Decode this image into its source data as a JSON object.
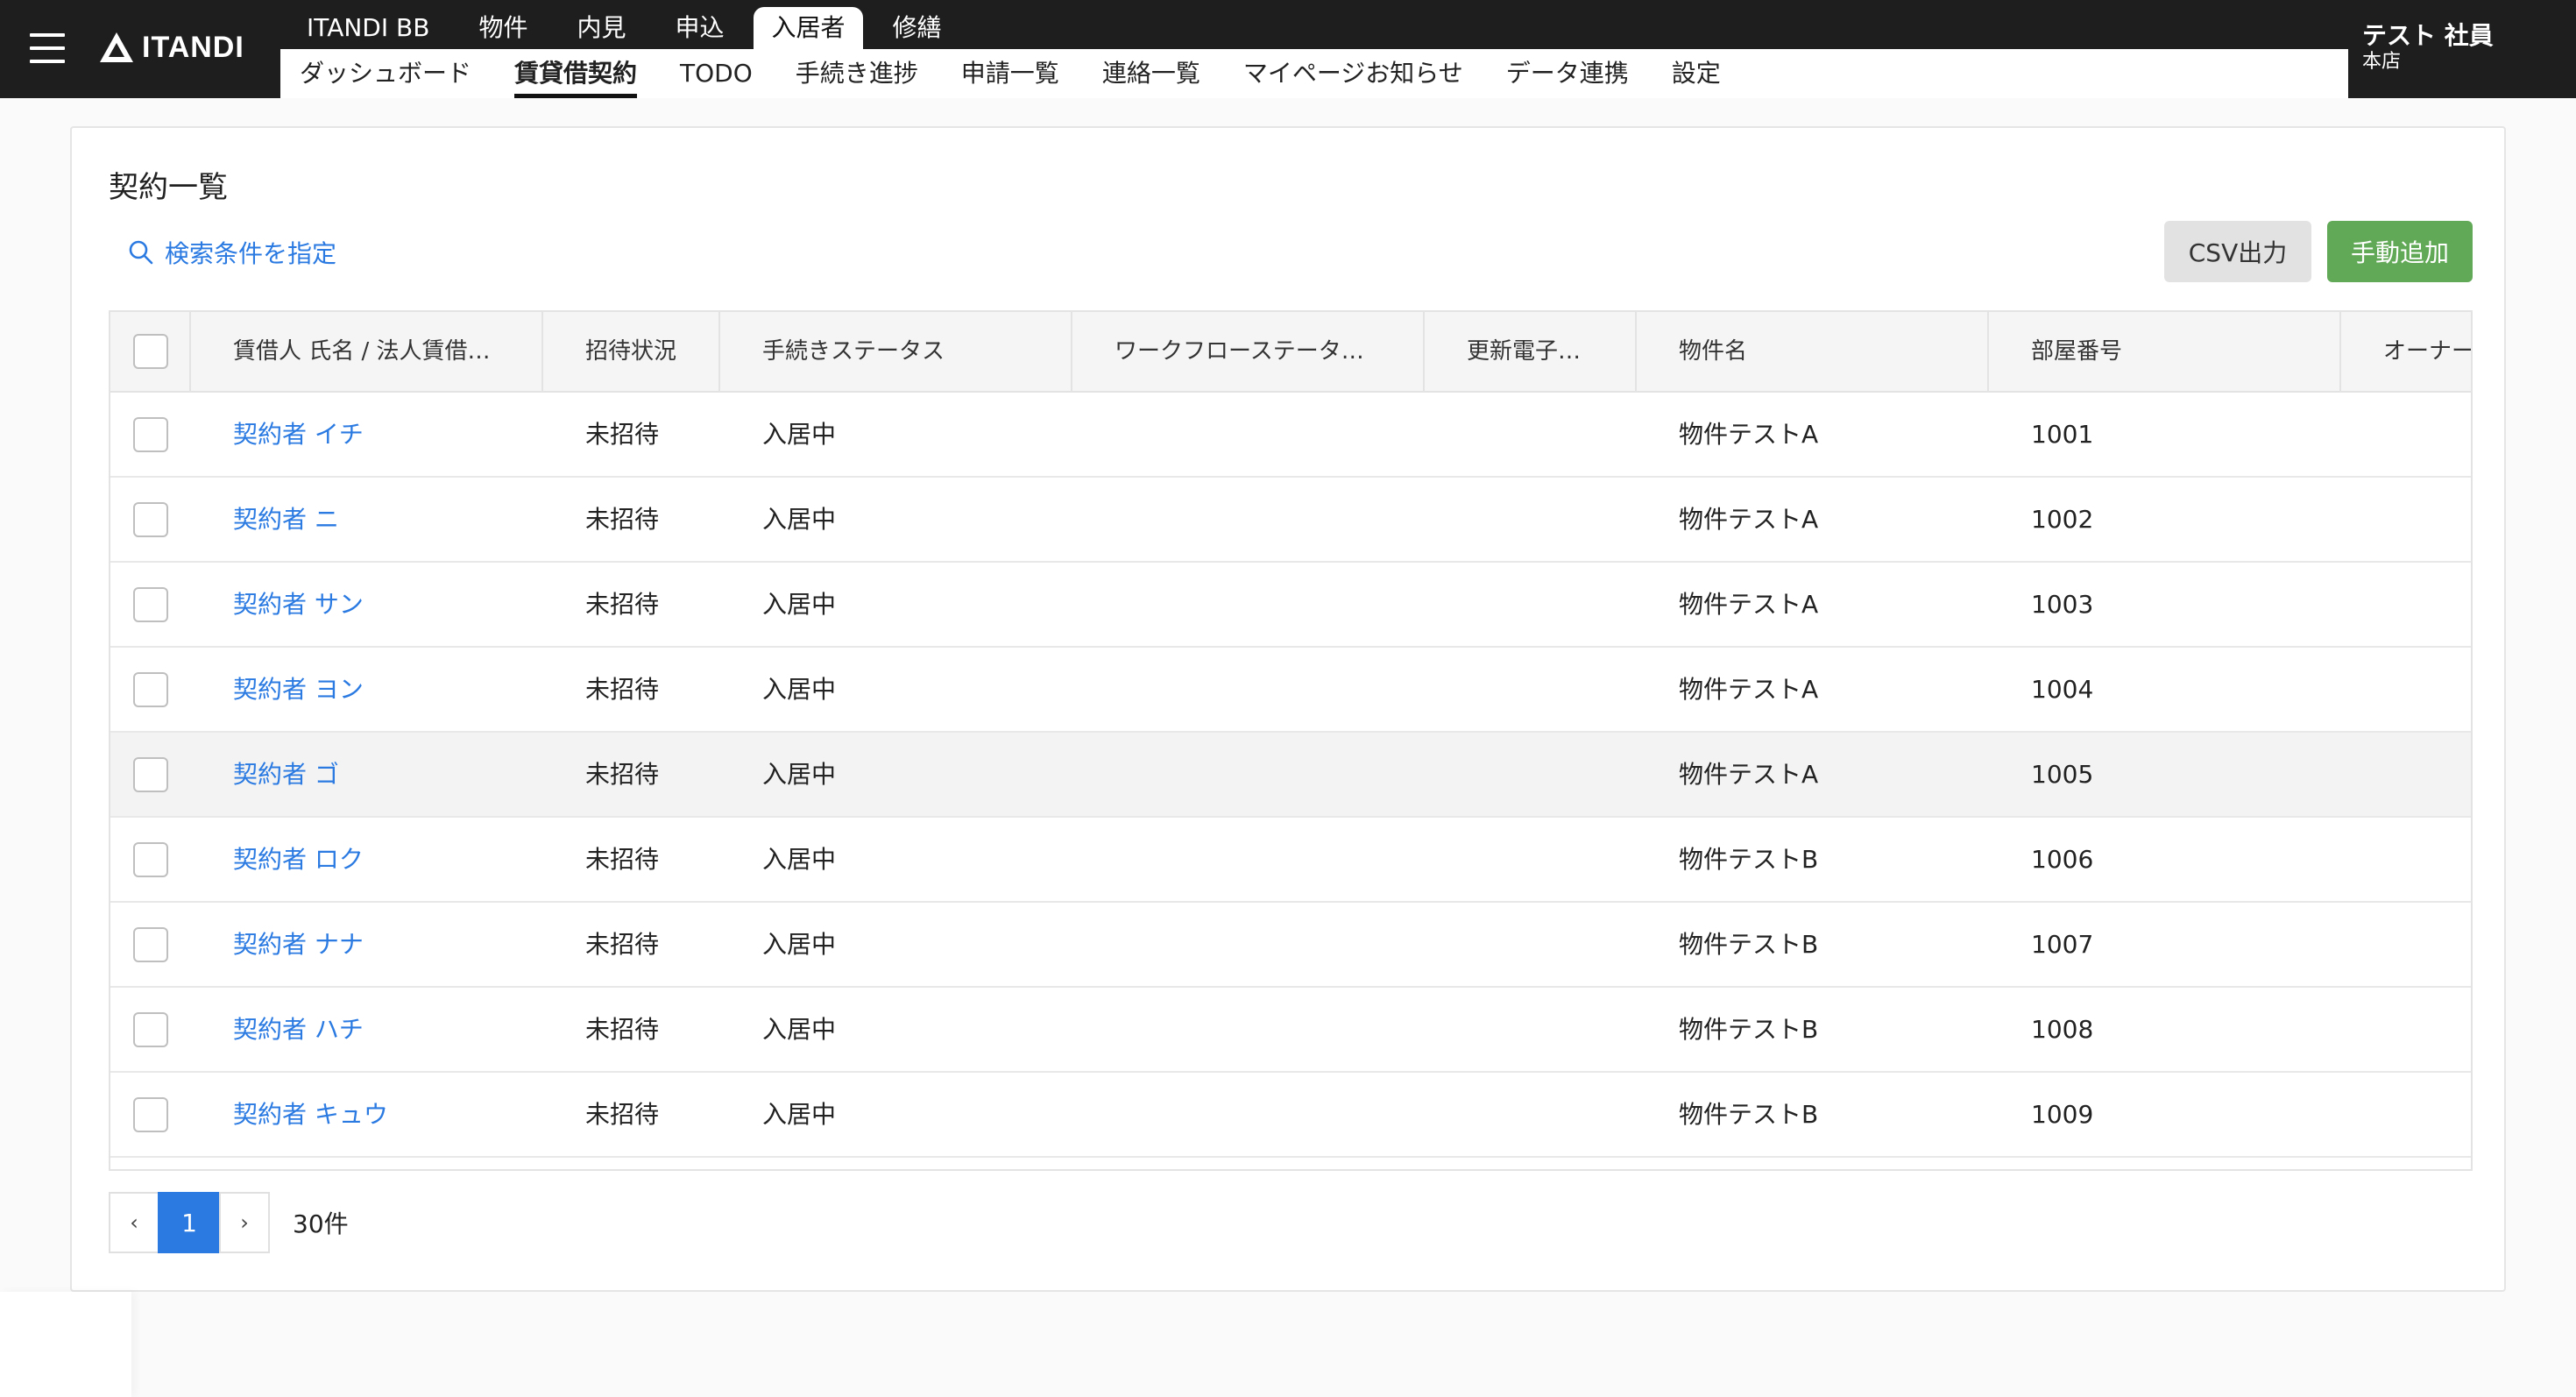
{
  "header": {
    "logo_text": "ITANDI",
    "primary_nav": [
      {
        "label": "ITANDI BB",
        "active": false
      },
      {
        "label": "物件",
        "active": false
      },
      {
        "label": "内見",
        "active": false
      },
      {
        "label": "申込",
        "active": false
      },
      {
        "label": "入居者",
        "active": true
      },
      {
        "label": "修繕",
        "active": false
      }
    ],
    "secondary_nav": [
      {
        "label": "ダッシュボード",
        "active": false
      },
      {
        "label": "賃貸借契約",
        "active": true
      },
      {
        "label": "TODO",
        "active": false
      },
      {
        "label": "手続き進捗",
        "active": false
      },
      {
        "label": "申請一覧",
        "active": false
      },
      {
        "label": "連絡一覧",
        "active": false
      },
      {
        "label": "マイページお知らせ",
        "active": false
      },
      {
        "label": "データ連携",
        "active": false
      },
      {
        "label": "設定",
        "active": false
      }
    ],
    "user": {
      "name": "テスト 社員",
      "branch": "本店"
    }
  },
  "main": {
    "title": "契約一覧",
    "search_link": "検索条件を指定",
    "csv_button": "CSV出力",
    "add_button": "手動追加"
  },
  "table": {
    "columns": [
      "賃借人 氏名 / 法人賃借…",
      "招待状況",
      "手続きステータス",
      "ワークフローステータ…",
      "更新電子…",
      "物件名",
      "部屋番号",
      "オーナー"
    ],
    "rows": [
      {
        "name": "契約者 イチ",
        "invite": "未招待",
        "status": "入居中",
        "workflow": "",
        "renewal": "",
        "property": "物件テストA",
        "room": "1001",
        "owner": ""
      },
      {
        "name": "契約者 ニ",
        "invite": "未招待",
        "status": "入居中",
        "workflow": "",
        "renewal": "",
        "property": "物件テストA",
        "room": "1002",
        "owner": ""
      },
      {
        "name": "契約者 サン",
        "invite": "未招待",
        "status": "入居中",
        "workflow": "",
        "renewal": "",
        "property": "物件テストA",
        "room": "1003",
        "owner": ""
      },
      {
        "name": "契約者 ヨン",
        "invite": "未招待",
        "status": "入居中",
        "workflow": "",
        "renewal": "",
        "property": "物件テストA",
        "room": "1004",
        "owner": ""
      },
      {
        "name": "契約者 ゴ",
        "invite": "未招待",
        "status": "入居中",
        "workflow": "",
        "renewal": "",
        "property": "物件テストA",
        "room": "1005",
        "owner": ""
      },
      {
        "name": "契約者 ロク",
        "invite": "未招待",
        "status": "入居中",
        "workflow": "",
        "renewal": "",
        "property": "物件テストB",
        "room": "1006",
        "owner": ""
      },
      {
        "name": "契約者 ナナ",
        "invite": "未招待",
        "status": "入居中",
        "workflow": "",
        "renewal": "",
        "property": "物件テストB",
        "room": "1007",
        "owner": ""
      },
      {
        "name": "契約者 ハチ",
        "invite": "未招待",
        "status": "入居中",
        "workflow": "",
        "renewal": "",
        "property": "物件テストB",
        "room": "1008",
        "owner": ""
      },
      {
        "name": "契約者 キュウ",
        "invite": "未招待",
        "status": "入居中",
        "workflow": "",
        "renewal": "",
        "property": "物件テストB",
        "room": "1009",
        "owner": ""
      }
    ]
  },
  "pagination": {
    "prev": "‹",
    "current": "1",
    "next": "›",
    "total": "30件"
  },
  "colors": {
    "accent": "#2a7ae2",
    "add_button": "#62a957",
    "header_bg": "#1e1e1e"
  }
}
